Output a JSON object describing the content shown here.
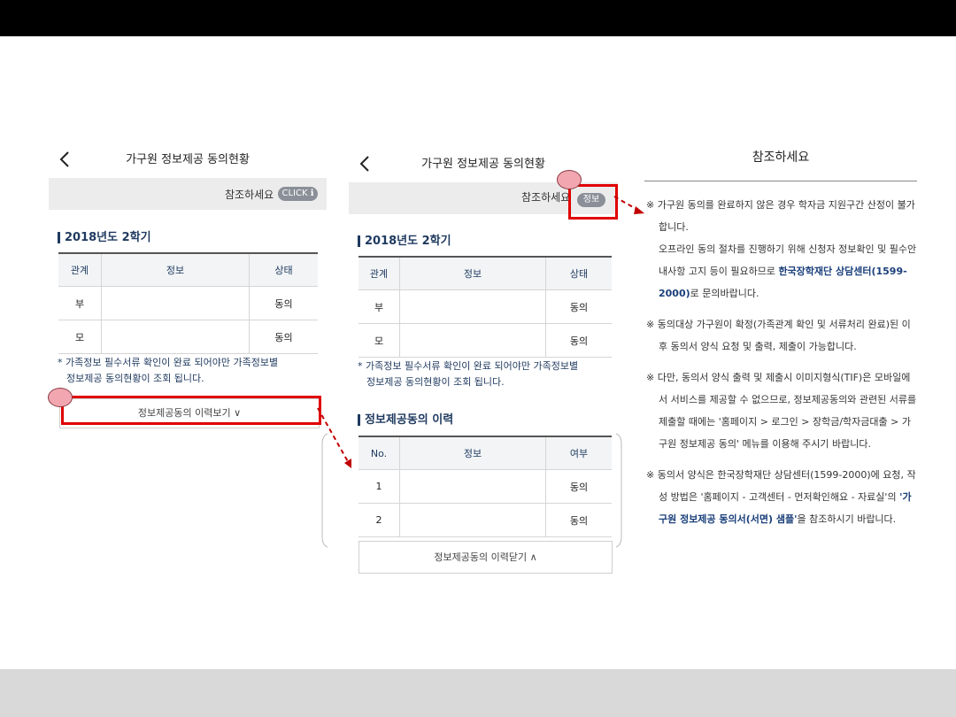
{
  "title": "가구원 정보제공 동의현황",
  "ref_label": "참조하세요",
  "click_pill": "CLICK ℹ",
  "info_pill": "정보",
  "semester_title": "2018년도 2학기",
  "consent_table": {
    "headers": [
      "관계",
      "정보",
      "상태"
    ],
    "rows": [
      {
        "relation": "부",
        "info": "",
        "status": "동의"
      },
      {
        "relation": "모",
        "info": "",
        "status": "동의"
      }
    ]
  },
  "family_note": [
    "* 가족정보 필수서류 확인이 완료 되어야만 가족정보별",
    "정보제공 동의현황이 조회 됩니다."
  ],
  "history_open_label": "정보제공동의 이력보기 ∨",
  "history_title": "정보제공동의 이력",
  "history_table": {
    "headers": [
      "No.",
      "정보",
      "여부"
    ],
    "rows": [
      {
        "no": "1",
        "info": "",
        "status": "동의"
      },
      {
        "no": "2",
        "info": "",
        "status": "동의"
      }
    ]
  },
  "history_close_label": "정보제공동의 이력닫기 ∧",
  "notes": {
    "title": "참조하세요",
    "items": [
      [
        "※ 가구원 동의를 완료하지 않은 경우 학자금 지원구간 산정이 불가합니다.",
        "오프라인 동의 절차를 진행하기 위해 신청자 정보확인 및 필수안내사항 고지 등이 필요하므로 ",
        "한국장학재단 상담센터(1599-2000)",
        "로 문의바랍니다."
      ],
      [
        "※ 동의대상 가구원이 확정(가족관계 확인 및 서류처리 완료)된 이후 동의서 양식 요청 및 출력, 제출이 가능합니다."
      ],
      [
        "※ 다만, 동의서 양식 출력 및 제출시 이미지형식(TIF)은 모바일에서 서비스를 제공할 수 없으므로, 정보제공동의와 관련된 서류를 제출할 때에는 '홈페이지 > 로그인 > 장학금/학자금대출 > 가구원 정보제공 동의' 메뉴를 이용해 주시기 바랍니다."
      ],
      [
        "※ 동의서 양식은 한국장학재단 상담센터(1599-2000)에 요청, 작성 방법은 '홈페이지 - 고객센터 - 먼저확인해요 - 자료실'의 ",
        "'가구원 정보제공 동의서(서면) 샘플'",
        "을 참조하시기 바랍니다."
      ]
    ]
  },
  "colors": {
    "accent": "#1f3a5f",
    "highlight_box": "#e00000",
    "marker": "#f2a7b0"
  }
}
